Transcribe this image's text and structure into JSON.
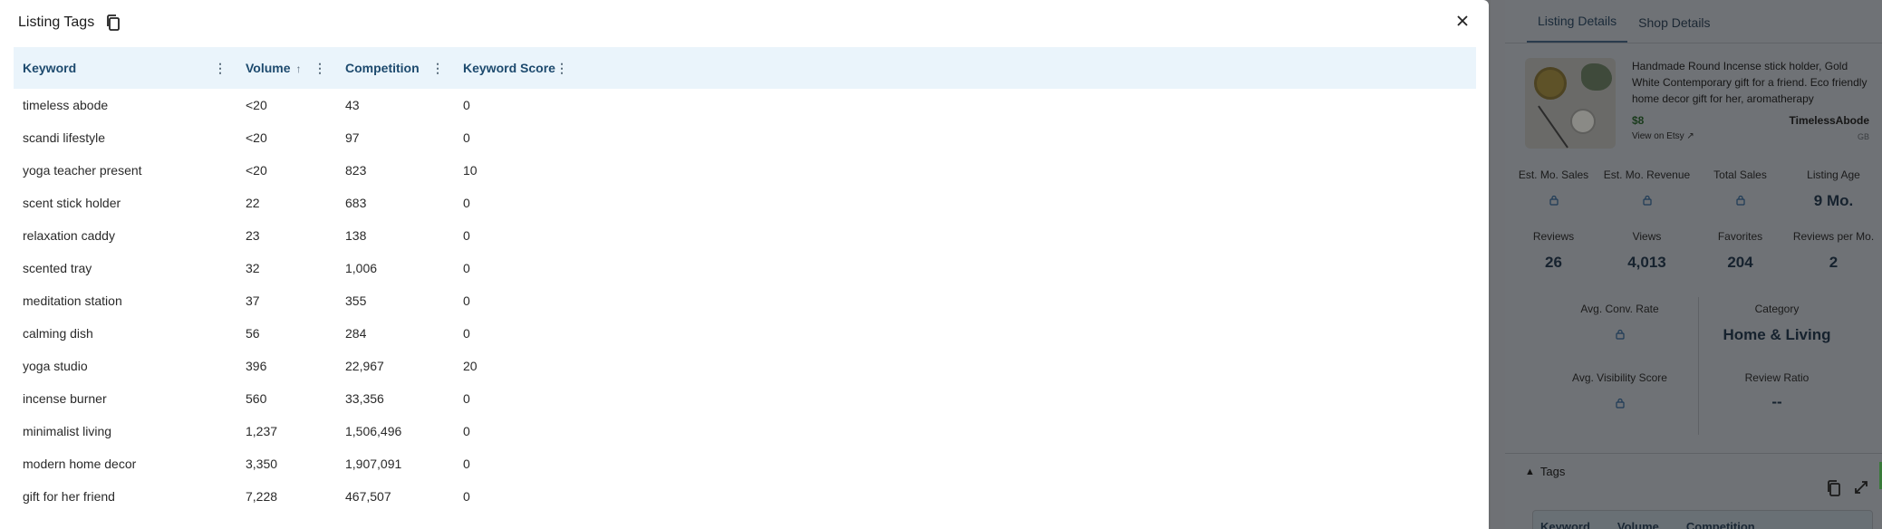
{
  "modal": {
    "title": "Listing Tags",
    "close_label": "×",
    "columns": [
      {
        "label": "Keyword"
      },
      {
        "label": "Volume",
        "sort": "↑"
      },
      {
        "label": "Competition"
      },
      {
        "label": "Keyword Score"
      }
    ],
    "rows": [
      [
        "timeless abode",
        "<20",
        "43",
        "0"
      ],
      [
        "scandi lifestyle",
        "<20",
        "97",
        "0"
      ],
      [
        "yoga teacher present",
        "<20",
        "823",
        "10"
      ],
      [
        "scent stick holder",
        "22",
        "683",
        "0"
      ],
      [
        "relaxation caddy",
        "23",
        "138",
        "0"
      ],
      [
        "scented tray",
        "32",
        "1,006",
        "0"
      ],
      [
        "meditation station",
        "37",
        "355",
        "0"
      ],
      [
        "calming dish",
        "56",
        "284",
        "0"
      ],
      [
        "yoga studio",
        "396",
        "22,967",
        "20"
      ],
      [
        "incense burner",
        "560",
        "33,356",
        "0"
      ],
      [
        "minimalist living",
        "1,237",
        "1,506,496",
        "0"
      ],
      [
        "modern home decor",
        "3,350",
        "1,907,091",
        "0"
      ],
      [
        "gift for her friend",
        "7,228",
        "467,507",
        "0"
      ]
    ]
  },
  "panel": {
    "tabs": [
      "Listing Details",
      "Shop Details"
    ],
    "listing": {
      "title": "Handmade Round Incense stick holder, Gold White Contemporary gift for a friend. Eco friendly home decor gift for her,  aromatherapy",
      "price": "$8",
      "shop": "TimelessAbode",
      "etsy_link": "View on Etsy ↗",
      "country": "GB"
    },
    "stats": [
      {
        "label": "Est. Mo. Sales",
        "value": null,
        "locked": true
      },
      {
        "label": "Est. Mo. Revenue",
        "value": null,
        "locked": true
      },
      {
        "label": "Total Sales",
        "value": null,
        "locked": true
      },
      {
        "label": "Listing Age",
        "value": "9 Mo."
      },
      {
        "label": "Reviews",
        "value": "26"
      },
      {
        "label": "Views",
        "value": "4,013"
      },
      {
        "label": "Favorites",
        "value": "204"
      },
      {
        "label": "Reviews per Mo.",
        "value": "2"
      }
    ],
    "stats2": {
      "conv_label": "Avg. Conv. Rate",
      "category_label": "Category",
      "category_value": "Home & Living",
      "visibility_label": "Avg. Visibility Score",
      "review_ratio_label": "Review Ratio",
      "review_ratio_value": "--"
    },
    "tags": {
      "title": "Tags",
      "mini_headers": [
        "Keyword",
        "Volume",
        "Competition"
      ]
    }
  },
  "colors": {
    "header_bg": "#eaf4fb",
    "header_text": "#1d4a6e",
    "overlay": "#6f7276"
  }
}
